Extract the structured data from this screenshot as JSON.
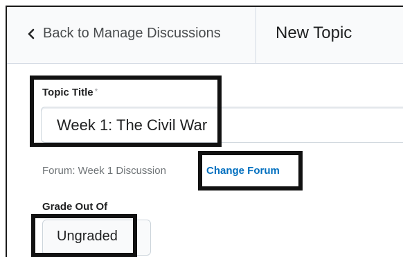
{
  "header": {
    "back_label": "Back to Manage Discussions",
    "title": "New Topic"
  },
  "form": {
    "topic_title_label": "Topic Title",
    "required_marker": "*",
    "topic_title_value": "Week 1: The Civil War",
    "forum_text": "Forum: Week 1 Discussion",
    "change_forum_label": "Change Forum",
    "grade_label": "Grade Out Of",
    "grade_value": "Ungraded"
  },
  "colors": {
    "link": "#006fbf",
    "highlight_border": "#111111",
    "header_bg": "#f9fafb"
  },
  "icons": {
    "back": "chevron-left-icon"
  }
}
